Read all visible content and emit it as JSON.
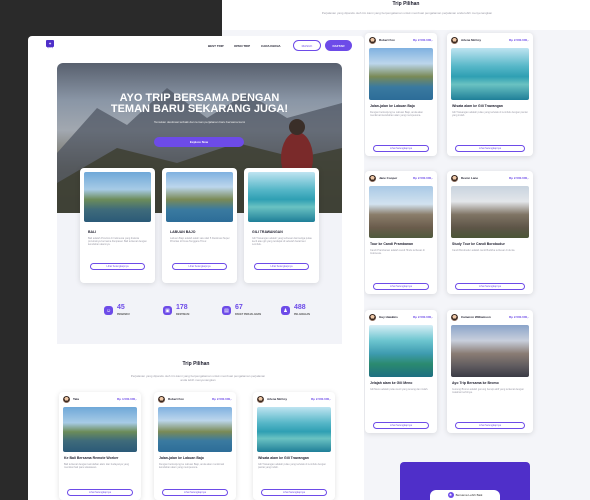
{
  "back_page": {
    "title": "Trip Pilihan",
    "subtitle": "Perjalanan yang dipandu oleh tim kami yang berpengalaman untuk membuat pengalaman perjalanan anda lebih menyenangkan",
    "cards": [
      {
        "user": "Robert Fox",
        "price": "Rp 2.500.000,-",
        "title": "Jalan-jalan ke Labuan Bajo",
        "desc": "Dengan berkunjung ke Labuan Bajo, anda akan menikmati keindahan alam yang mempesona.",
        "btn": "Lihat Selengkapnya"
      },
      {
        "user": "Arlene McCoy",
        "price": "Rp 2.500.000,-",
        "title": "Wisata alam ke Gili Trawangan",
        "desc": "Gili Trawangan adalah pulau yang terletak di Lombok dengan pantai yang indah.",
        "btn": "Lihat Selengkapnya"
      },
      {
        "user": "Jane Cooper",
        "price": "Rp 2.500.000,-",
        "title": "Tour ke Candi Prambanan",
        "desc": "Candi Prambanan adalah candi Hindu terbesar di Indonesia.",
        "btn": "Lihat Selengkapnya"
      },
      {
        "user": "Devon Lane",
        "price": "Rp 2.500.000,-",
        "title": "Study Tour ke Candi Borobudur",
        "desc": "Candi Borobudur adalah candi Buddha terbesar di dunia.",
        "btn": "Lihat Selengkapnya"
      },
      {
        "user": "Guy Hawkins",
        "price": "Rp 2.500.000,-",
        "title": "Jelajah alam ke Gili Meno",
        "desc": "Gili Meno adalah pulau kecil yang tenang dan indah.",
        "btn": "Lihat Selengkapnya"
      },
      {
        "user": "Cameron Williamson",
        "price": "Rp 2.500.000,-",
        "title": "Ayo Trip Bersama ke Bromo",
        "desc": "Gunung Bromo adalah gunung berapi aktif yang terkenal dengan matahari terbitnya.",
        "btn": "Lihat Selengkapnya"
      }
    ],
    "join_label": "Bersama Lebih Baik"
  },
  "front_page": {
    "nav": {
      "logo": "ayotrip",
      "links": [
        "BEST TRIP",
        "OPEN TRIP",
        "CARA KERJA"
      ],
      "login": "MASUK",
      "signup": "DAFTAR"
    },
    "hero": {
      "title": "AYO TRIP BERSAMA DENGAN TEMAN BARU SEKARANG JUGA!",
      "subtitle": "Temukan destinasi terbaik dan teman perjalanan baru bersama kami",
      "cta": "Explore Now"
    },
    "destinations": [
      {
        "name": "BALI",
        "desc": "Bali adalah Provinsi di Indonesia yang ibukota provinsinya bernama Denpasar. Bali terkenal dengan keindahan alamnya.",
        "btn": "Lihat Selengkapnya"
      },
      {
        "name": "LABUAN BAJO",
        "desc": "Labuan Bajo adalah salah satu dari 5 Destinasi Super Prioritas di Nusa Tenggara Timur.",
        "btn": "Lihat Selengkapnya"
      },
      {
        "name": "GILI TRAWANGAN",
        "desc": "Gili Trawangan adalah yang terbesar dari ketiga pulau kecil atau gili yang terdapat di sebelah barat laut Lombok.",
        "btn": "Lihat Selengkapnya"
      }
    ],
    "stats": [
      {
        "value": "45",
        "label": "PEMANDU",
        "icon": "guide-icon"
      },
      {
        "value": "178",
        "label": "DESTINASI",
        "icon": "map-icon"
      },
      {
        "value": "67",
        "label": "PAKET PERJALANAN",
        "icon": "package-icon"
      },
      {
        "value": "488",
        "label": "PELANGGAN",
        "icon": "users-icon"
      }
    ],
    "trips": {
      "title": "Trip Pilihan",
      "subtitle": "Perjalanan yang dipandu oleh tim kami yang berpengalaman untuk membuat pengalaman perjalanan anda lebih menyenangkan",
      "cards": [
        {
          "user": "Tata",
          "price": "Rp 4.500.000,-",
          "title": "Ke Bali Bersama Remote Worker",
          "desc": "Bali terkenal dengan keindahan alam dan budayanya yang memikat hati para wisatawan.",
          "btn": "Lihat Selengkapnya"
        },
        {
          "user": "Robert Fox",
          "price": "Rp 2.500.000,-",
          "title": "Jalan-jalan ke Labuan Bajo",
          "desc": "Dengan berkunjung ke Labuan Bajo, anda akan menikmati keindahan alam yang mempesona.",
          "btn": "Lihat Selengkapnya"
        },
        {
          "user": "Arlene McCoy",
          "price": "Rp 2.500.000,-",
          "title": "Wisata alam ke Gili Trawangan",
          "desc": "Gili Trawangan adalah pulau yang terletak di Lombok dengan pantai yang indah.",
          "btn": "Lihat Selengkapnya"
        }
      ]
    }
  },
  "colors": {
    "accent": "#6d4be8",
    "background": "#2a2a2a",
    "surface": "#f2f3f8"
  }
}
